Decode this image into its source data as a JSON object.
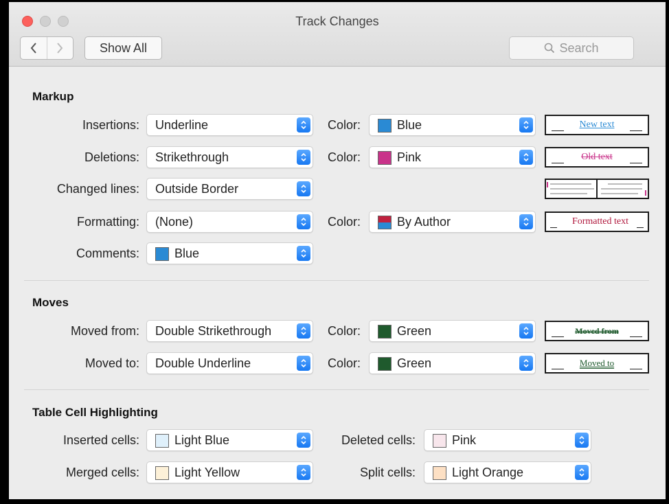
{
  "window": {
    "title": "Track Changes"
  },
  "toolbar": {
    "back_icon": "chevron-left-icon",
    "forward_icon": "chevron-right-icon",
    "show_all_label": "Show All",
    "search_placeholder": "Search"
  },
  "markup": {
    "title": "Markup",
    "insertions": {
      "label": "Insertions:",
      "value": "Underline",
      "color_label": "Color:",
      "color": "Blue",
      "swatch": "#2a8ad4",
      "preview": "New text"
    },
    "deletions": {
      "label": "Deletions:",
      "value": "Strikethrough",
      "color_label": "Color:",
      "color": "Pink",
      "swatch": "#c9338a",
      "preview": "Old text"
    },
    "changed_lines": {
      "label": "Changed lines:",
      "value": "Outside Border"
    },
    "formatting": {
      "label": "Formatting:",
      "value": "(None)",
      "color_label": "Color:",
      "color": "By Author",
      "preview": "Formatted text"
    },
    "comments": {
      "label": "Comments:",
      "value": "Blue",
      "swatch": "#2a8ad4"
    }
  },
  "moves": {
    "title": "Moves",
    "moved_from": {
      "label": "Moved from:",
      "value": "Double Strikethrough",
      "color_label": "Color:",
      "color": "Green",
      "swatch": "#1f5a2d",
      "preview": "Moved from"
    },
    "moved_to": {
      "label": "Moved to:",
      "value": "Double Underline",
      "color_label": "Color:",
      "color": "Green",
      "swatch": "#1f5a2d",
      "preview": "Moved to"
    }
  },
  "table": {
    "title": "Table Cell Highlighting",
    "inserted": {
      "label": "Inserted cells:",
      "value": "Light Blue",
      "swatch": "#dff0fb"
    },
    "deleted": {
      "label": "Deleted cells:",
      "value": "Pink",
      "swatch": "#f8e6ec"
    },
    "merged": {
      "label": "Merged cells:",
      "value": "Light Yellow",
      "swatch": "#fdf1d8"
    },
    "split": {
      "label": "Split cells:",
      "value": "Light Orange",
      "swatch": "#fde0c4"
    }
  },
  "accent": "#1778f2"
}
